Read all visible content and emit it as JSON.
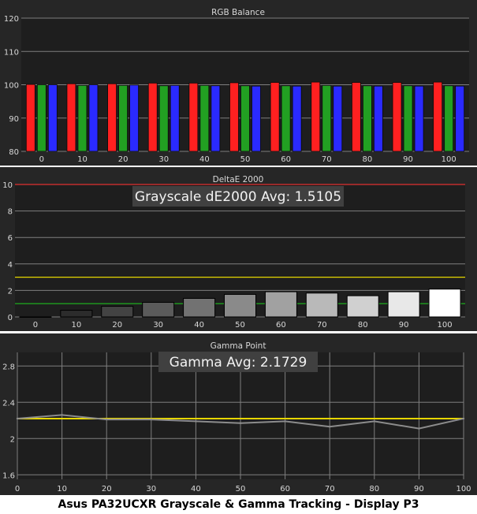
{
  "caption": "Asus PA32UCXR Grayscale & Gamma Tracking - Display P3",
  "colors": {
    "background": "#262626",
    "plot": "#1e1e1e",
    "grid": "#7f7f7f",
    "text": "#d8d8d8",
    "red": "#ff2020",
    "green": "#22a022",
    "blue": "#2a2aff",
    "target_line": "#e6d600",
    "good_line": "#1fa01f",
    "limit_line": "#e03030",
    "gamma_line": "#8c8c8c"
  },
  "chart_data": [
    {
      "type": "bar",
      "title": "RGB Balance",
      "categories": [
        "0",
        "10",
        "20",
        "30",
        "40",
        "50",
        "60",
        "70",
        "80",
        "90",
        "100"
      ],
      "series": [
        {
          "color": "red",
          "values": [
            100.1,
            100.3,
            100.3,
            100.5,
            100.5,
            100.6,
            100.7,
            100.8,
            100.7,
            100.7,
            100.8
          ]
        },
        {
          "color": "green",
          "values": [
            100.0,
            99.8,
            99.8,
            99.7,
            99.8,
            99.7,
            99.7,
            99.8,
            99.7,
            99.7,
            99.7
          ]
        },
        {
          "color": "blue",
          "values": [
            100.0,
            100.0,
            99.9,
            99.8,
            99.7,
            99.6,
            99.6,
            99.6,
            99.6,
            99.6,
            99.6
          ]
        }
      ],
      "ylim": [
        80,
        120
      ],
      "yticks": [
        80,
        90,
        100,
        110,
        120
      ],
      "grid": true
    },
    {
      "type": "bar",
      "title": "DeltaE 2000",
      "annotation": "Grayscale dE2000 Avg: 1.5105",
      "categories": [
        "0",
        "10",
        "20",
        "30",
        "40",
        "50",
        "60",
        "70",
        "80",
        "90",
        "100"
      ],
      "values": [
        0.0,
        0.5,
        0.8,
        1.1,
        1.4,
        1.7,
        1.9,
        1.8,
        1.6,
        1.9,
        2.1
      ],
      "reference_lines": [
        {
          "value": 10,
          "color": "limit_line"
        },
        {
          "value": 3,
          "color": "target_line"
        },
        {
          "value": 1,
          "color": "good_line"
        }
      ],
      "ylim": [
        0,
        10
      ],
      "yticks": [
        0,
        2,
        4,
        6,
        8,
        10
      ],
      "grid": true
    },
    {
      "type": "line",
      "title": "Gamma Point",
      "annotation": "Gamma Avg: 2.1729",
      "x": [
        0,
        10,
        20,
        30,
        40,
        50,
        60,
        70,
        80,
        90,
        100
      ],
      "series": [
        {
          "color": "gamma_line",
          "values": [
            2.22,
            2.26,
            2.21,
            2.21,
            2.19,
            2.17,
            2.19,
            2.13,
            2.19,
            2.11,
            2.22
          ]
        }
      ],
      "target": {
        "value": 2.22,
        "color": "target_line"
      },
      "xlim": [
        0,
        100
      ],
      "ylim": [
        1.55,
        2.95
      ],
      "yticks": [
        "1.6",
        "2",
        "2.4",
        "2.8"
      ],
      "xticks": [
        0,
        10,
        20,
        30,
        40,
        50,
        60,
        70,
        80,
        90,
        100
      ],
      "grid": true
    }
  ]
}
